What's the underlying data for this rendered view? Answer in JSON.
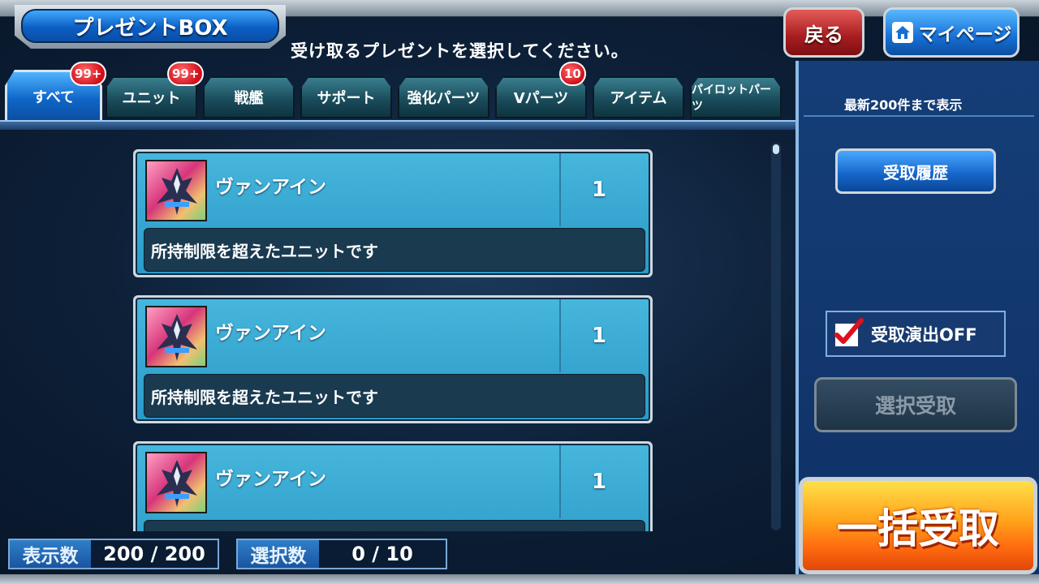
{
  "header": {
    "title": "プレゼントBOX",
    "instruction": "受け取るプレゼントを選択してください。",
    "back_label": "戻る",
    "mypage_label": "マイページ"
  },
  "tabs": [
    {
      "label": "すべて",
      "badge": "99+",
      "active": true
    },
    {
      "label": "ユニット",
      "badge": "99+"
    },
    {
      "label": "戦艦"
    },
    {
      "label": "サポート"
    },
    {
      "label": "強化パーツ"
    },
    {
      "label": "Vパーツ",
      "badge": "10"
    },
    {
      "label": "アイテム"
    },
    {
      "label": "パイロットパーツ"
    }
  ],
  "items": [
    {
      "name": "ヴァンアイン",
      "qty": "1",
      "note": "所持制限を超えたユニットです"
    },
    {
      "name": "ヴァンアイン",
      "qty": "1",
      "note": "所持制限を超えたユニットです"
    },
    {
      "name": "ヴァンアイン",
      "qty": "1",
      "note": ""
    }
  ],
  "counters": {
    "display_label": "表示数",
    "display_value": "200 / 200",
    "selected_label": "選択数",
    "selected_value": "0 / 10"
  },
  "side": {
    "info": "最新200件まで表示",
    "history_label": "受取履歴",
    "effect_off_label": "受取演出OFF",
    "effect_off_checked": true,
    "select_receive_label": "選択受取",
    "bulk_receive_label": "一括受取"
  },
  "colors": {
    "accent_blue": "#0f66c8",
    "back_red": "#a71c20",
    "bulk_orange": "#ff8a10",
    "badge_red": "#d0101c"
  }
}
